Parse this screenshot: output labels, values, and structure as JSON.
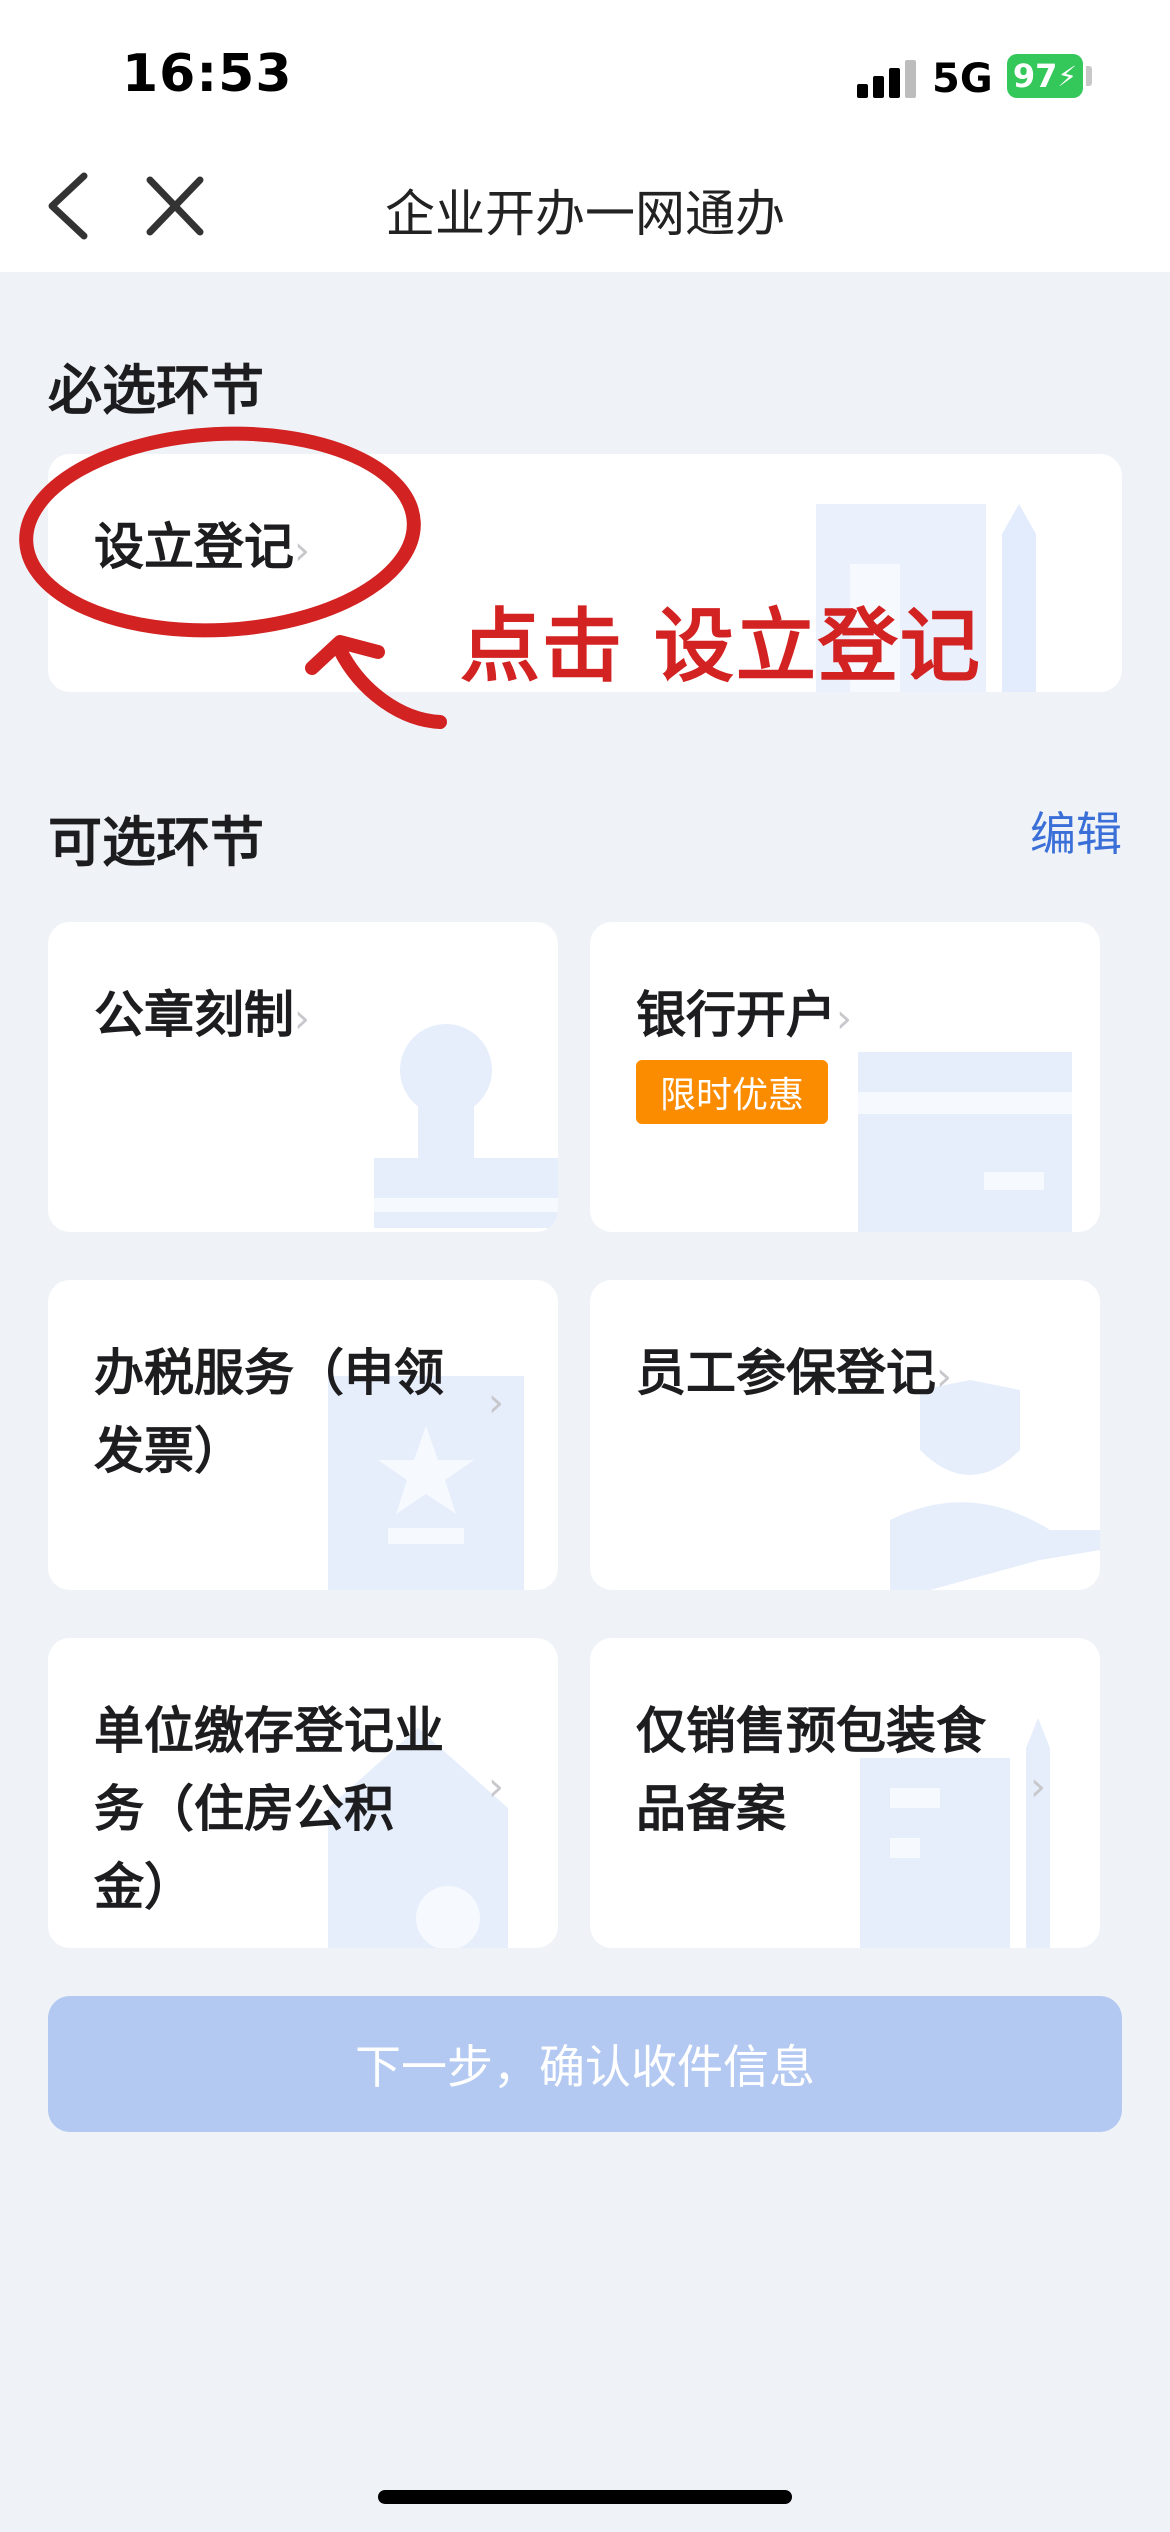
{
  "status_bar": {
    "time": "16:53",
    "network": "5G",
    "battery": "97"
  },
  "nav": {
    "title": "企业开办一网通办",
    "back_icon": "chevron-left-icon",
    "close_icon": "close-icon"
  },
  "required": {
    "title": "必选环节",
    "items": [
      {
        "label": "设立登记",
        "chevron": "›"
      }
    ]
  },
  "annotation": {
    "text": "点击 设立登记",
    "color": "#d32222"
  },
  "optional": {
    "title": "可选环节",
    "edit_label": "编辑",
    "items": [
      {
        "label": "公章刻制",
        "chevron": "›"
      },
      {
        "label": "银行开户",
        "chevron": "›",
        "badge": "限时优惠"
      },
      {
        "label_line1": "办税服务（申领",
        "label_line2": "发票）",
        "chevron": "›"
      },
      {
        "label": "员工参保登记",
        "chevron": "›"
      },
      {
        "label_line1": "单位缴存登记业",
        "label_line2": "务（住房公积",
        "label_line3": "金）",
        "chevron": "›"
      },
      {
        "label_line1": "仅销售预包装食",
        "label_line2": "品备案",
        "chevron": "›"
      }
    ]
  },
  "next_button": {
    "label": "下一步，确认收件信息"
  },
  "colors": {
    "accent": "#3b6fd8",
    "badge": "#fb8c00",
    "button_disabled": "#b3c9f1",
    "background": "#eff3f8",
    "battery": "#34c759"
  }
}
